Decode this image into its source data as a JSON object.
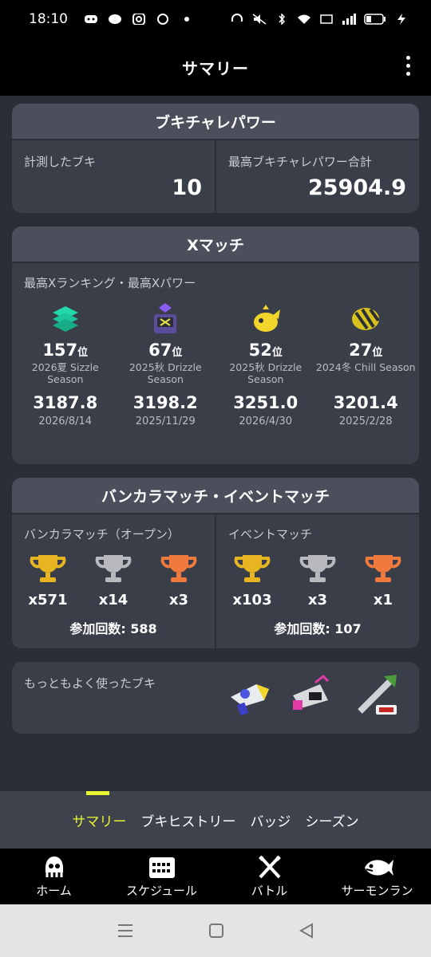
{
  "status": {
    "time": "18:10",
    "left_icons": [
      "discord-icon",
      "line-icon",
      "instagram-icon",
      "chat-icon",
      "dot-icon"
    ],
    "right_icons": [
      "headset-icon",
      "mute-icon",
      "bluetooth-icon",
      "wifi-icon",
      "volte-icon",
      "signal-icon",
      "battery-icon",
      "charging-icon"
    ]
  },
  "header": {
    "title": "サマリー"
  },
  "buki_power": {
    "title": "ブキチャレパワー",
    "measured_label": "計測したブキ",
    "measured_value": "10",
    "total_label": "最高ブキチャレパワー合計",
    "total_value": "25904.9"
  },
  "x_match": {
    "title": "Xマッチ",
    "subtitle": "最高Xランキング・最高Xパワー",
    "modes": [
      {
        "icon": "splat-zones-icon",
        "rank": "157",
        "rank_suffix": "位",
        "season": "2026夏 Sizzle Season",
        "power": "3187.8",
        "date": "2026/8/14"
      },
      {
        "icon": "tower-control-icon",
        "rank": "67",
        "rank_suffix": "位",
        "season": "2025秋 Drizzle Season",
        "power": "3198.2",
        "date": "2025/11/29"
      },
      {
        "icon": "rainmaker-icon",
        "rank": "52",
        "rank_suffix": "位",
        "season": "2025秋 Drizzle Season",
        "power": "3251.0",
        "date": "2026/4/30"
      },
      {
        "icon": "clam-blitz-icon",
        "rank": "27",
        "rank_suffix": "位",
        "season": "2024冬 Chill Season",
        "power": "3201.4",
        "date": "2025/2/28"
      }
    ]
  },
  "bankara": {
    "title": "バンカラマッチ・イベントマッチ",
    "open": {
      "label": "バンカラマッチ（オープン）",
      "trophies": [
        {
          "icon": "gold-trophy-icon",
          "count": "x571",
          "color": "#e7b521"
        },
        {
          "icon": "silver-trophy-icon",
          "count": "x14",
          "color": "#b8b9bd"
        },
        {
          "icon": "bronze-trophy-icon",
          "count": "x3",
          "color": "#f07a3e"
        }
      ],
      "participation": "参加回数: 588"
    },
    "event": {
      "label": "イベントマッチ",
      "trophies": [
        {
          "icon": "gold-trophy-icon",
          "count": "x103",
          "color": "#e7b521"
        },
        {
          "icon": "silver-trophy-icon",
          "count": "x3",
          "color": "#b8b9bd"
        },
        {
          "icon": "bronze-trophy-icon",
          "count": "x1",
          "color": "#f07a3e"
        }
      ],
      "participation": "参加回数: 107"
    }
  },
  "most_used": {
    "label": "もっともよく使ったブキ",
    "weapons": [
      "blaster-weapon-icon",
      "dualie-weapon-icon",
      "brush-weapon-icon"
    ]
  },
  "subnav": {
    "tabs": [
      "サマリー",
      "ブキヒストリー",
      "バッジ",
      "シーズン"
    ],
    "active": "サマリー"
  },
  "bottom_nav": {
    "items": [
      {
        "label": "ホーム",
        "icon": "squid-home-icon"
      },
      {
        "label": "スケジュール",
        "icon": "calendar-icon"
      },
      {
        "label": "バトル",
        "icon": "battle-icon"
      },
      {
        "label": "サーモンラン",
        "icon": "salmon-icon"
      }
    ]
  },
  "colors": {
    "accent": "#e8f531",
    "card": "#3a3e48",
    "card_header": "#4a4f5b",
    "background": "#2b2e36"
  }
}
